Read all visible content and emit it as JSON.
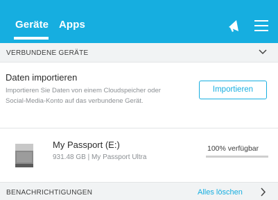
{
  "header": {
    "tabs": [
      {
        "label": "Geräte",
        "active": true
      },
      {
        "label": "Apps",
        "active": false
      }
    ],
    "icons": [
      "megaphone-icon",
      "hamburger-menu-icon"
    ],
    "background_color": "#16aee0"
  },
  "connected_devices": {
    "section_title": "VERBUNDENE GERÄTE",
    "import": {
      "title": "Daten importieren",
      "description": "Importieren Sie Daten von einem Cloudspeicher oder Social-Media-Konto auf das verbundene Gerät.",
      "button_label": "Importieren"
    },
    "devices": [
      {
        "name": "My Passport (E:)",
        "subtitle": "931.48 GB | My Passport Ultra",
        "availability": "100% verfügbar",
        "available_fraction": 1.0
      }
    ]
  },
  "notifications": {
    "section_title": "BENACHRICHTIGUNGEN",
    "clear_label": "Alles löschen"
  },
  "colors": {
    "accent": "#16aee0",
    "section_bg": "#f1f3f4"
  }
}
